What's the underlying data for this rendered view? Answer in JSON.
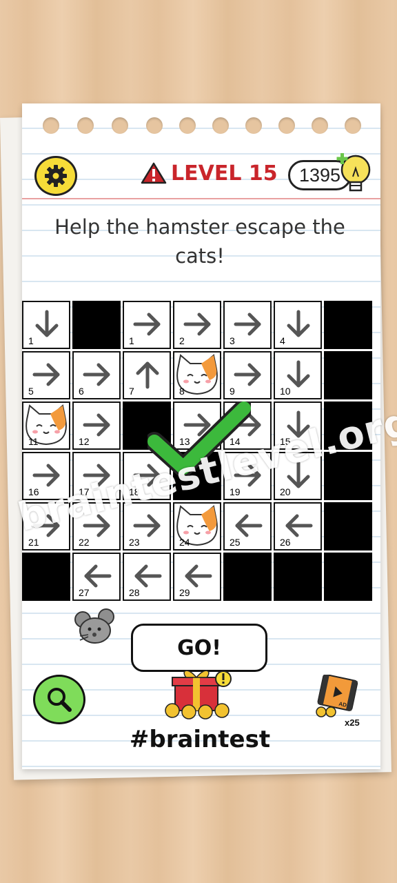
{
  "header": {
    "level_label": "LEVEL 15",
    "coins": "1395"
  },
  "question": "Help the hamster escape the cats!",
  "grid": {
    "cells": [
      {
        "n": "1",
        "dir": "down"
      },
      {
        "n": "",
        "dir": "black"
      },
      {
        "n": "1",
        "dir": "right"
      },
      {
        "n": "2",
        "dir": "right"
      },
      {
        "n": "3",
        "dir": "right"
      },
      {
        "n": "4",
        "dir": "down"
      },
      {
        "n": "",
        "dir": "black"
      },
      {
        "n": "5",
        "dir": "right"
      },
      {
        "n": "6",
        "dir": "right"
      },
      {
        "n": "7",
        "dir": "up"
      },
      {
        "n": "8",
        "dir": "cat"
      },
      {
        "n": "9",
        "dir": "right"
      },
      {
        "n": "10",
        "dir": "down"
      },
      {
        "n": "",
        "dir": "black"
      },
      {
        "n": "11",
        "dir": "cat"
      },
      {
        "n": "12",
        "dir": "right"
      },
      {
        "n": "",
        "dir": "black"
      },
      {
        "n": "13",
        "dir": "right"
      },
      {
        "n": "14",
        "dir": "right"
      },
      {
        "n": "15",
        "dir": "down"
      },
      {
        "n": "",
        "dir": "black"
      },
      {
        "n": "16",
        "dir": "right"
      },
      {
        "n": "17",
        "dir": "right"
      },
      {
        "n": "18",
        "dir": "right"
      },
      {
        "n": "",
        "dir": "black"
      },
      {
        "n": "19",
        "dir": "right"
      },
      {
        "n": "20",
        "dir": "down"
      },
      {
        "n": "",
        "dir": "black"
      },
      {
        "n": "21",
        "dir": "right"
      },
      {
        "n": "22",
        "dir": "right"
      },
      {
        "n": "23",
        "dir": "right"
      },
      {
        "n": "24",
        "dir": "cat"
      },
      {
        "n": "25",
        "dir": "left"
      },
      {
        "n": "26",
        "dir": "left"
      },
      {
        "n": "",
        "dir": "black"
      },
      {
        "n": "",
        "dir": "black"
      },
      {
        "n": "27",
        "dir": "left"
      },
      {
        "n": "28",
        "dir": "left"
      },
      {
        "n": "29",
        "dir": "left"
      },
      {
        "n": "",
        "dir": "black"
      },
      {
        "n": "",
        "dir": "black"
      },
      {
        "n": "",
        "dir": "black"
      }
    ]
  },
  "actions": {
    "go_label": "GO!",
    "hashtag": "#braintest",
    "ad_count": "x25"
  },
  "watermark": "braintestlevel.org",
  "icons": {
    "settings": "gear-icon",
    "warning": "warning-icon",
    "hint_bulb": "lightbulb-icon",
    "search": "magnifier-icon",
    "gift": "gift-icon",
    "ad": "video-ad-icon",
    "check": "checkmark-icon",
    "hamster": "mouse-icon",
    "cat": "cat-face-icon"
  },
  "colors": {
    "level_red": "#c9252b",
    "gear_yellow": "#f6dc38",
    "hint_green": "#7fdc5a",
    "check_green": "#3cb93c"
  }
}
